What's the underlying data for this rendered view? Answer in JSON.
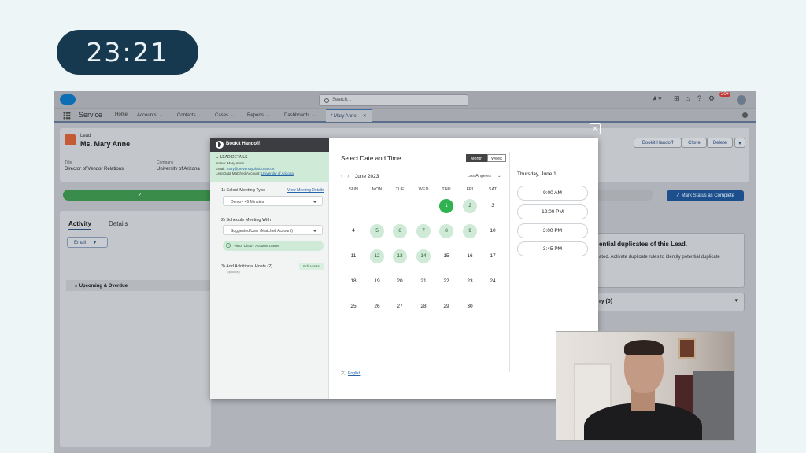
{
  "timer": "23:21",
  "salesforce": {
    "search_placeholder": "Search...",
    "notif_count": "20+",
    "app_name": "Service",
    "nav": [
      "Home",
      "Accounts",
      "Contacts",
      "Cases",
      "Reports",
      "Dashboards"
    ],
    "open_tab": "* Mary Anne",
    "record": {
      "type": "Lead",
      "name": "Ms. Mary Anne",
      "title_label": "Title",
      "title_value": "Director of Vendor Relations",
      "company_label": "Company",
      "company_value": "University of Arizona",
      "buttons": [
        "Bookit Handoff",
        "Clone",
        "Delete"
      ]
    },
    "path_check": "✓",
    "mark_complete": "✓ Mark Status as Complete",
    "tabs": [
      "Activity",
      "Details"
    ],
    "email_button": "Email",
    "upcoming": "Upcoming & Overdue",
    "duplicates_title": "ential duplicates of this Lead.",
    "duplicates_text": "ated. Activate duplicate rules to identify potential duplicate",
    "related_label": "ry (0)"
  },
  "modal": {
    "header": "Bookit Handoff",
    "lead_details": {
      "title": "LEAD DETAILS",
      "name": "Name: Mary Anne",
      "email_prefix": "Email: ",
      "email": "mary@universityofarizona.com",
      "matched_prefix": "LeanData Matched Account: ",
      "matched": "University of Arizona"
    },
    "step1": "1) Select Meeting Type",
    "view_details": "View Meeting Details",
    "meeting_type": "Demo - 45 Minutes",
    "step2": "2) Schedule Meeting With",
    "schedule_with": "Suggested User (Matched Account)",
    "owner_chip": "Victor Chau - Account Owner",
    "step3": "3) Add Additional Hosts (2)",
    "step3_note": "(optional)",
    "edit_hosts": "Edit Hosts",
    "select_title": "Select Date and Time",
    "view_month": "Month",
    "view_week": "Week",
    "month_label": "June 2023",
    "timezone": "Los Angeles",
    "weekdays": [
      "SUN",
      "MON",
      "TUE",
      "WED",
      "THU",
      "FRI",
      "SAT"
    ],
    "selected_day": "Thursday, June 1",
    "slots": [
      "9:00 AM",
      "12:00 PM",
      "3:00 PM",
      "3:45 PM"
    ],
    "language": "English"
  }
}
